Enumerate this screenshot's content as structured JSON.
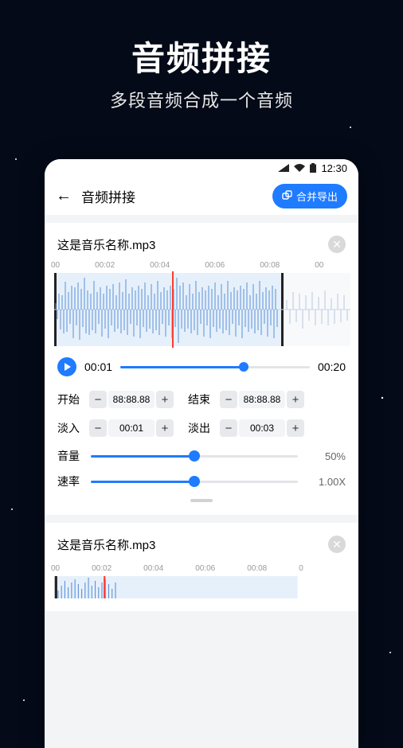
{
  "hero": {
    "title": "音频拼接",
    "subtitle": "多段音频合成一个音频"
  },
  "status": {
    "time": "12:30"
  },
  "header": {
    "title": "音频拼接",
    "export_label": "合并导出"
  },
  "clips": [
    {
      "filename": "这是音乐名称.mp3",
      "ruler": [
        "00",
        "00:02",
        "00:04",
        "00:06",
        "00:08",
        "00"
      ],
      "play_pos": "00:01",
      "duration": "00:20",
      "start_label": "开始",
      "start_value": "88:88.88",
      "end_label": "结束",
      "end_value": "88:88.88",
      "fadein_label": "淡入",
      "fadein_value": "00:01",
      "fadeout_label": "淡出",
      "fadeout_value": "00:03",
      "volume_label": "音量",
      "volume_value": "50%",
      "speed_label": "速率",
      "speed_value": "1.00X"
    },
    {
      "filename": "这是音乐名称.mp3",
      "ruler": [
        "00",
        "00:02",
        "00:04",
        "00:06",
        "00:08",
        "0"
      ]
    }
  ]
}
